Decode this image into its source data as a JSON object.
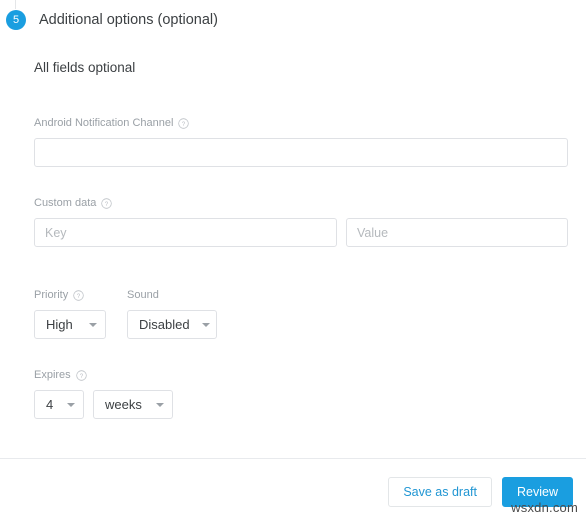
{
  "step": {
    "number": "5",
    "title": "Additional options (optional)",
    "badge_color": "#1a9ee0"
  },
  "section": {
    "title": "All fields optional"
  },
  "fields": {
    "android_channel": {
      "label": "Android Notification Channel",
      "help_icon": "help-circle-icon",
      "value": "",
      "placeholder": ""
    },
    "custom_data": {
      "label": "Custom data",
      "help_icon": "help-circle-icon",
      "key": {
        "value": "",
        "placeholder": "Key"
      },
      "value_field": {
        "value": "",
        "placeholder": "Value"
      }
    },
    "priority": {
      "label": "Priority",
      "help_icon": "help-circle-icon",
      "selected": "High"
    },
    "sound": {
      "label": "Sound",
      "selected": "Disabled"
    },
    "expires": {
      "label": "Expires",
      "help_icon": "help-circle-icon",
      "amount": "4",
      "unit": "weeks"
    }
  },
  "footer": {
    "save_draft_label": "Save as draft",
    "review_label": "Review",
    "primary_color": "#1a9ee0",
    "link_color": "#2196d3"
  },
  "watermark": {
    "text": "wsxdn.com"
  }
}
